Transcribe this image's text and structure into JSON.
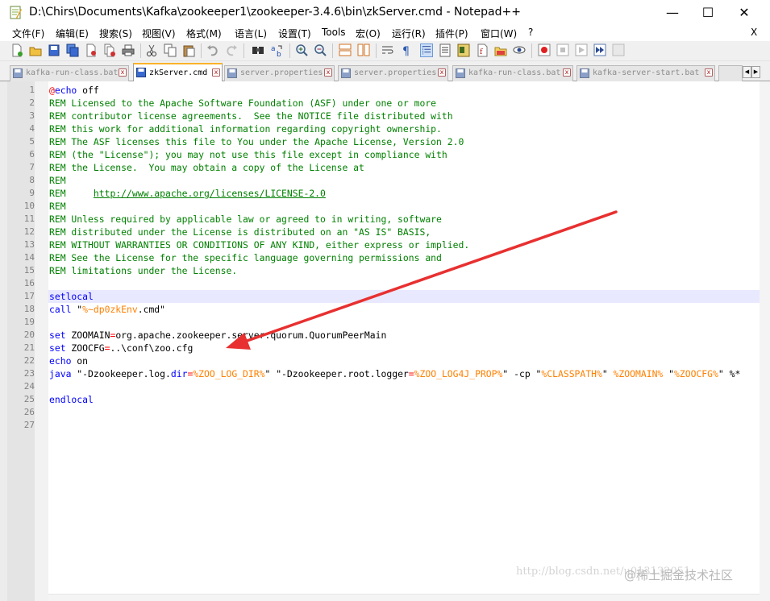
{
  "window": {
    "title": "D:\\Chirs\\Documents\\Kafka\\zookeeper1\\zookeeper-3.4.6\\bin\\zkServer.cmd - Notepad++",
    "minimize": "—",
    "maximize": "☐",
    "close": "✕"
  },
  "menu": {
    "items": [
      "文件(F)",
      "编辑(E)",
      "搜索(S)",
      "视图(V)",
      "格式(M)",
      "语言(L)",
      "设置(T)",
      "Tools",
      "宏(O)",
      "运行(R)",
      "插件(P)",
      "窗口(W)",
      "?"
    ],
    "close_label": "X"
  },
  "tabs": [
    {
      "label": "kafka-run-class.bat",
      "active": false
    },
    {
      "label": "zkServer.cmd",
      "active": true
    },
    {
      "label": "server.properties",
      "active": false
    },
    {
      "label": "server.properties",
      "active": false
    },
    {
      "label": "kafka-run-class.bat",
      "active": false
    },
    {
      "label": "kafka-server-start.bat",
      "active": false
    }
  ],
  "tab_close_symbol": "x",
  "editor": {
    "line_numbers": [
      "1",
      "2",
      "3",
      "4",
      "5",
      "6",
      "7",
      "8",
      "9",
      "10",
      "11",
      "12",
      "13",
      "14",
      "15",
      "16",
      "17",
      "18",
      "19",
      "20",
      "21",
      "22",
      "23",
      "24",
      "25",
      "26",
      "27"
    ],
    "current_line": 17,
    "lines": [
      [
        [
          "op",
          "@"
        ],
        [
          "kw",
          "echo"
        ],
        [
          "tx",
          " off"
        ]
      ],
      [
        [
          "rem",
          "REM Licensed to the Apache Software Foundation (ASF) under one or more"
        ]
      ],
      [
        [
          "rem",
          "REM contributor license agreements.  See the NOTICE file distributed with"
        ]
      ],
      [
        [
          "rem",
          "REM this work for additional information regarding copyright ownership."
        ]
      ],
      [
        [
          "rem",
          "REM The ASF licenses this file to You under the Apache License, Version 2.0"
        ]
      ],
      [
        [
          "rem",
          "REM (the \"License\"); you may not use this file except in compliance with"
        ]
      ],
      [
        [
          "rem",
          "REM the License.  You may obtain a copy of the License at"
        ]
      ],
      [
        [
          "rem",
          "REM"
        ]
      ],
      [
        [
          "rem",
          "REM     "
        ],
        [
          "url",
          "http://www.apache.org/licenses/LICENSE-2.0"
        ]
      ],
      [
        [
          "rem",
          "REM"
        ]
      ],
      [
        [
          "rem",
          "REM Unless required by applicable law or agreed to in writing, software"
        ]
      ],
      [
        [
          "rem",
          "REM distributed under the License is distributed on an \"AS IS\" BASIS,"
        ]
      ],
      [
        [
          "rem",
          "REM WITHOUT WARRANTIES OR CONDITIONS OF ANY KIND, either express or implied."
        ]
      ],
      [
        [
          "rem",
          "REM See the License for the specific language governing permissions and"
        ]
      ],
      [
        [
          "rem",
          "REM limitations under the License."
        ]
      ],
      [],
      [
        [
          "kw",
          "setlocal"
        ]
      ],
      [
        [
          "kw",
          "call"
        ],
        [
          "tx",
          " \""
        ],
        [
          "vr",
          "%~dp0zkEnv"
        ],
        [
          "tx",
          ".cmd\""
        ]
      ],
      [],
      [
        [
          "kw",
          "set"
        ],
        [
          "tx",
          " ZOOMAIN"
        ],
        [
          "op",
          "="
        ],
        [
          "tx",
          "org.apache.zookeeper.server.quorum.QuorumPeerMain"
        ]
      ],
      [
        [
          "kw",
          "set"
        ],
        [
          "tx",
          " ZOOCFG"
        ],
        [
          "op",
          "="
        ],
        [
          "tx",
          "..\\conf\\zoo.cfg"
        ]
      ],
      [
        [
          "kw",
          "echo"
        ],
        [
          "tx",
          " on"
        ]
      ],
      [
        [
          "kw",
          "java"
        ],
        [
          "tx",
          " \"-Dzookeeper.log."
        ],
        [
          "kw",
          "dir"
        ],
        [
          "op",
          "="
        ],
        [
          "vr",
          "%ZOO_LOG_DIR%"
        ],
        [
          "tx",
          "\" \"-Dzookeeper.root.logger"
        ],
        [
          "op",
          "="
        ],
        [
          "vr",
          "%ZOO_LOG4J_PROP%"
        ],
        [
          "tx",
          "\" -cp \""
        ],
        [
          "vr",
          "%CLASSPATH%"
        ],
        [
          "tx",
          "\" "
        ],
        [
          "vr",
          "%ZOOMAIN%"
        ],
        [
          "tx",
          " \""
        ],
        [
          "vr",
          "%ZOOCFG%"
        ],
        [
          "tx",
          "\" %*"
        ]
      ],
      [],
      [
        [
          "kw",
          "endlocal"
        ]
      ],
      [],
      []
    ]
  },
  "overlay": {
    "watermark": "http://blog.csdn.net/u013132051",
    "brand": "@稀土掘金技术社区"
  },
  "colors": {
    "comment": "#008000",
    "keyword": "#0000ff",
    "operator": "#ff0000",
    "variable": "#ff8000",
    "current_line": "#e8e8ff",
    "active_tab_accent": "#fab32b",
    "arrow": "#e83030"
  }
}
